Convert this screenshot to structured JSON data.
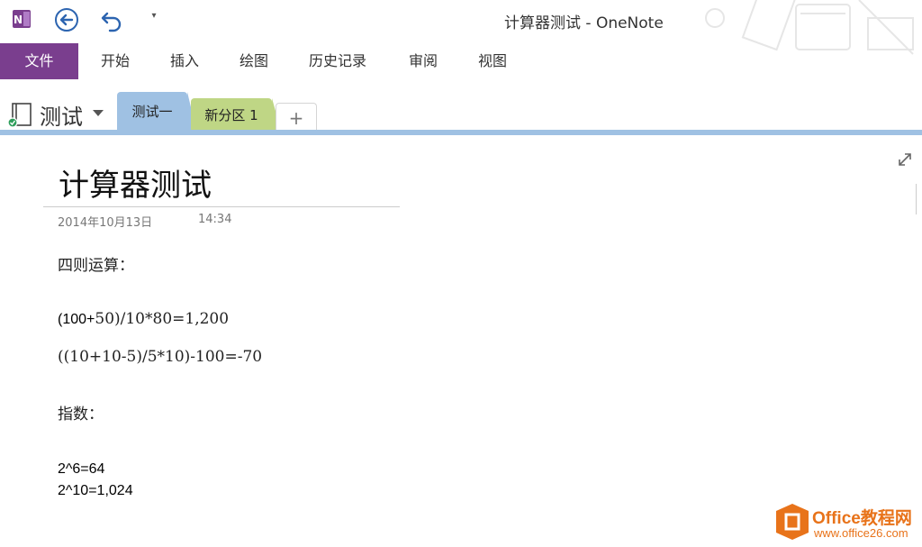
{
  "window": {
    "title": "计算器测试 - OneNote"
  },
  "ribbon": {
    "tabs": [
      "文件",
      "开始",
      "插入",
      "绘图",
      "历史记录",
      "审阅",
      "视图"
    ]
  },
  "notebook": {
    "name": "测试",
    "sections": [
      "测试一",
      "新分区 1"
    ],
    "add_section": "+"
  },
  "page": {
    "title": "计算器测试",
    "date": "2014年10月13日",
    "time": "14:34",
    "content": {
      "heading_arith": "四则运算：",
      "expr1_prefix": "(100+",
      "expr1_rest": "50)/10*80=1,200",
      "expr2": "((10+10-5)/5*10)-100=-70",
      "heading_exp": "指数：",
      "exp1": "2^6=64",
      "exp2": "2^10=1,024"
    }
  },
  "watermark": {
    "brand": "Office教程网",
    "url": "www.office26.com"
  },
  "colors": {
    "file_tab": "#7a3e8e",
    "section1": "#9fc1e3",
    "section2": "#bfd685",
    "accent": "#e8731a"
  }
}
